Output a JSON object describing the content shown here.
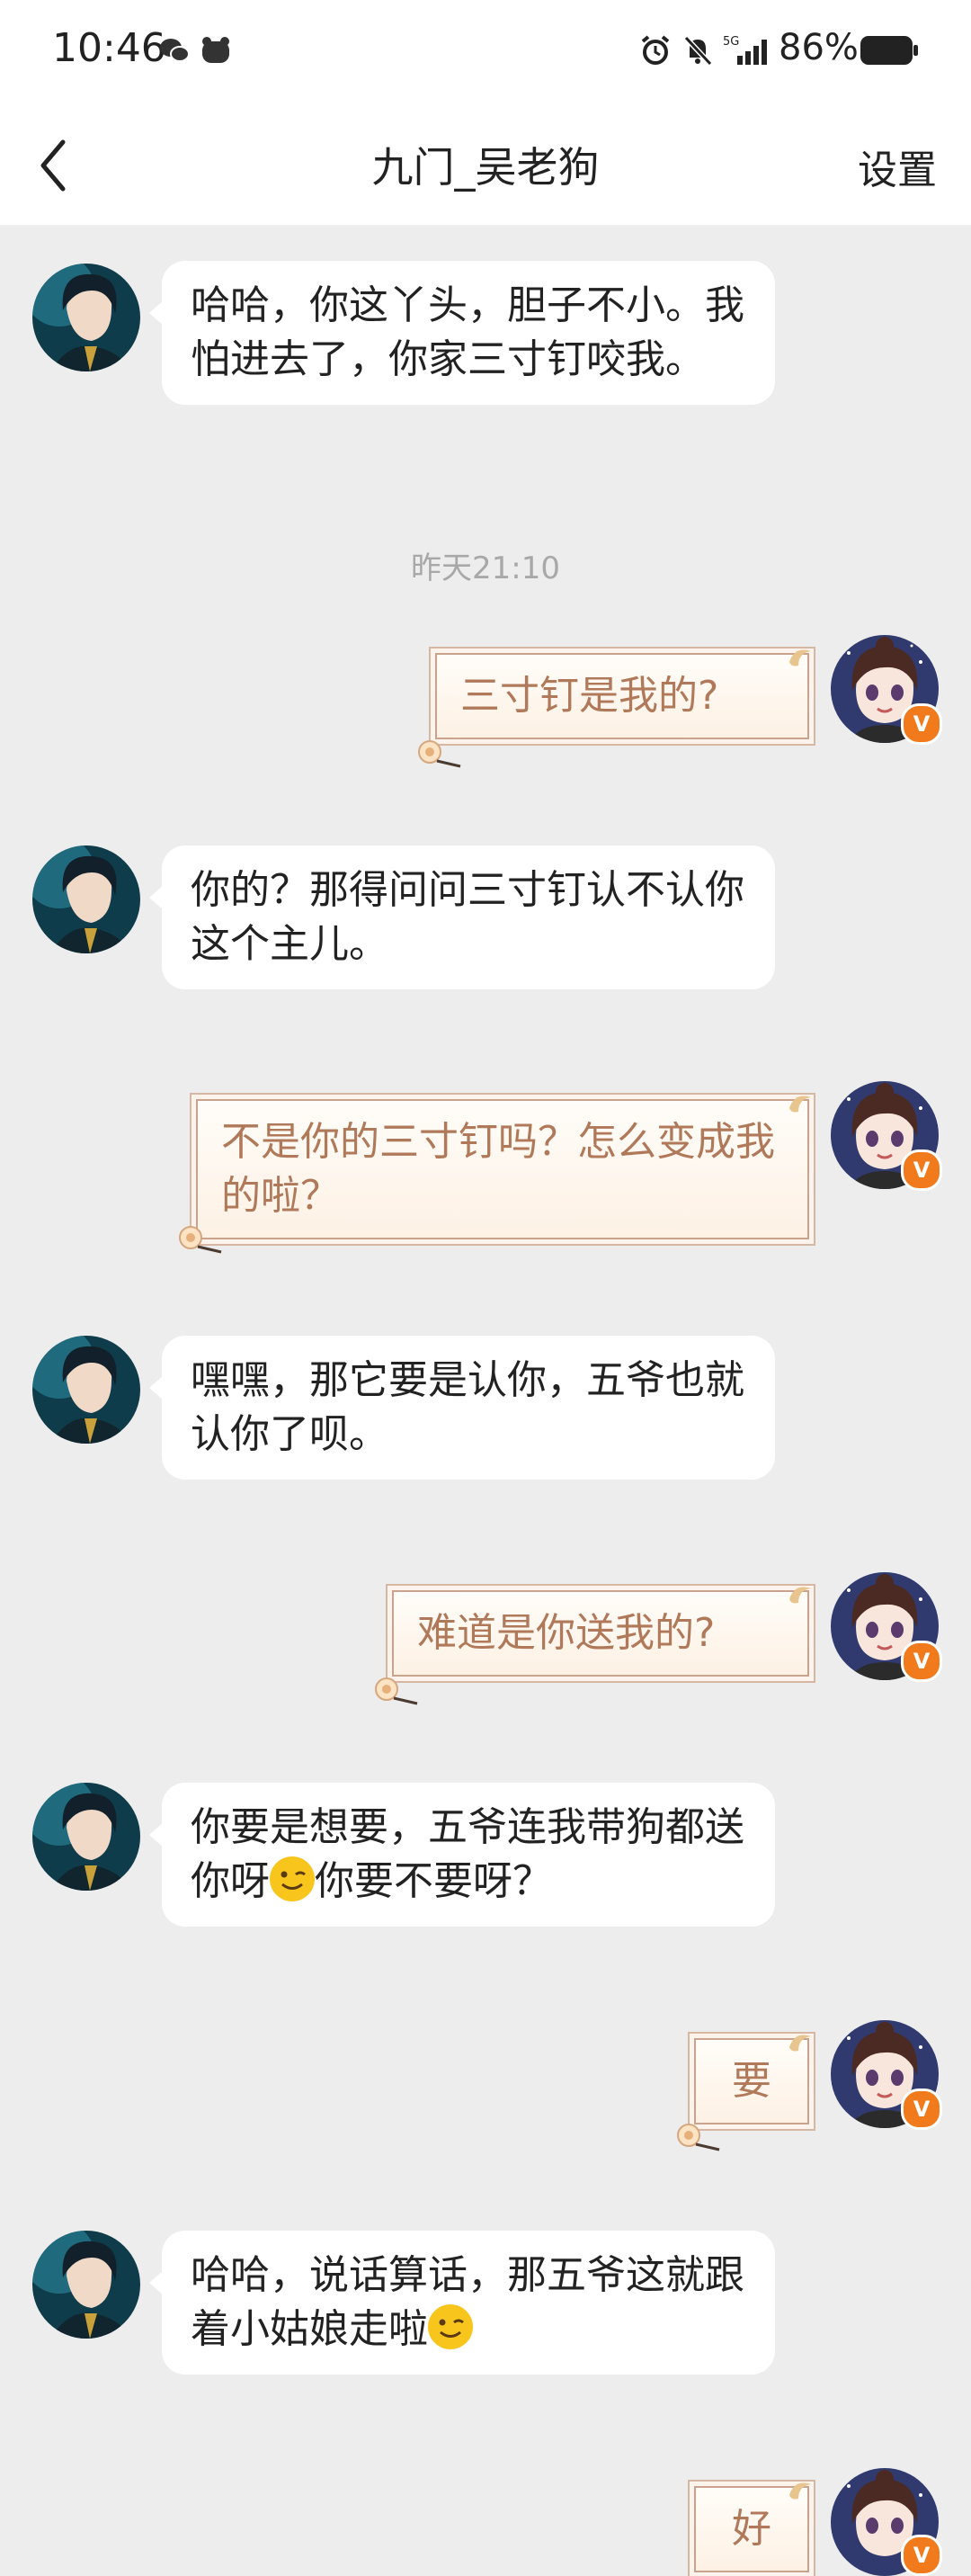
{
  "status_bar": {
    "time": "10:46",
    "network": "5G",
    "battery": "86%"
  },
  "header": {
    "back_icon": "chevron-left-icon",
    "title": "九门_吴老狗",
    "settings": "设置"
  },
  "timestamp": "昨天21:10",
  "messages": [
    {
      "side": "left",
      "text": "哈哈，你这丫头，胆子不小。我怕进去了，你家三寸钉咬我。"
    },
    {
      "side": "right",
      "text": "三寸钉是我的?"
    },
    {
      "side": "left",
      "text": "你的？那得问问三寸钉认不认你这个主儿。"
    },
    {
      "side": "right",
      "text": "不是你的三寸钉吗？怎么变成我的啦？"
    },
    {
      "side": "left",
      "text": "嘿嘿，那它要是认你，五爷也就认你了呗。"
    },
    {
      "side": "right",
      "text": "难道是你送我的?"
    },
    {
      "side": "left",
      "text_before": "你要是想要，五爷连我带狗都送你呀",
      "emoji": "wink-emoji",
      "text_after": "你要不要呀？"
    },
    {
      "side": "right",
      "text": "要"
    },
    {
      "side": "left",
      "text_before": "哈哈，说话算话，那五爷这就跟着小姑娘走啦",
      "emoji": "wink-emoji"
    },
    {
      "side": "right",
      "text": "好"
    }
  ],
  "badge_text": "V",
  "colors": {
    "badge": "#f07a1c",
    "right_text": "#b0795a",
    "background": "#ededed"
  }
}
